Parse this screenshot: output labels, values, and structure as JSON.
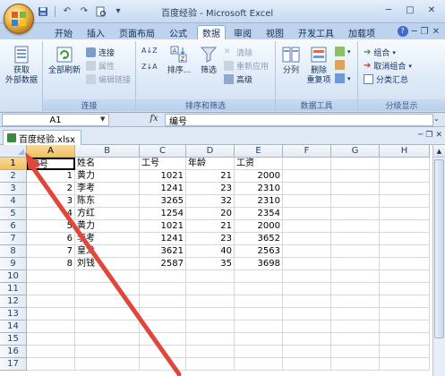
{
  "window": {
    "title": "百度经验 - Microsoft Excel",
    "controls": [
      "minimize",
      "maximize",
      "close"
    ]
  },
  "quick_access": [
    "save-icon",
    "undo-icon",
    "redo-icon",
    "print-preview-icon",
    "customize-icon"
  ],
  "ribbon": {
    "tabs": [
      "开始",
      "插入",
      "页面布局",
      "公式",
      "数据",
      "审阅",
      "视图",
      "开发工具",
      "加载项"
    ],
    "active_tab": "数据",
    "groups": {
      "get_external": {
        "button": "获取\n外部数据"
      },
      "connections": {
        "label": "连接",
        "refresh_all": "全部刷新",
        "items": [
          "连接",
          "属性",
          "编辑链接"
        ]
      },
      "sort_filter": {
        "label": "排序和筛选",
        "sort": "排序...",
        "filter": "筛选",
        "items": [
          "清除",
          "重新应用",
          "高级"
        ]
      },
      "data_tools": {
        "label": "数据工具",
        "split": "分列",
        "remove_dup": "删除\n重复项"
      },
      "outline": {
        "label": "分级显示",
        "items": [
          "组合",
          "取消组合",
          "分类汇总"
        ]
      }
    }
  },
  "formula_bar": {
    "name_box": "A1",
    "fx": "fx",
    "formula": "编号"
  },
  "workbook": {
    "tab_name": "百度经验.xlsx"
  },
  "sheet": {
    "columns": [
      "A",
      "B",
      "C",
      "D",
      "E",
      "F",
      "G",
      "H"
    ],
    "rows": [
      "1",
      "2",
      "3",
      "4",
      "5",
      "6",
      "7",
      "8",
      "9",
      "10",
      "11",
      "12",
      "13",
      "14",
      "15",
      "16",
      "17"
    ],
    "header_row": [
      "编号",
      "姓名",
      "工号",
      "年龄",
      "工资"
    ],
    "data": [
      [
        "1",
        "黄力",
        "1021",
        "21",
        "2000"
      ],
      [
        "2",
        "李考",
        "1241",
        "23",
        "2310"
      ],
      [
        "3",
        "陈东",
        "3265",
        "32",
        "2310"
      ],
      [
        "4",
        "方红",
        "1254",
        "20",
        "2354"
      ],
      [
        "5",
        "黄力",
        "1021",
        "21",
        "2000"
      ],
      [
        "6",
        "李考",
        "1241",
        "23",
        "3652"
      ],
      [
        "7",
        "皇龙",
        "3621",
        "40",
        "2563"
      ],
      [
        "8",
        "刘钱",
        "2587",
        "35",
        "3698"
      ]
    ],
    "active_cell": "A1"
  },
  "colors": {
    "annotation_arrow": "#e0463a",
    "selected_header": "#f1c15f"
  }
}
